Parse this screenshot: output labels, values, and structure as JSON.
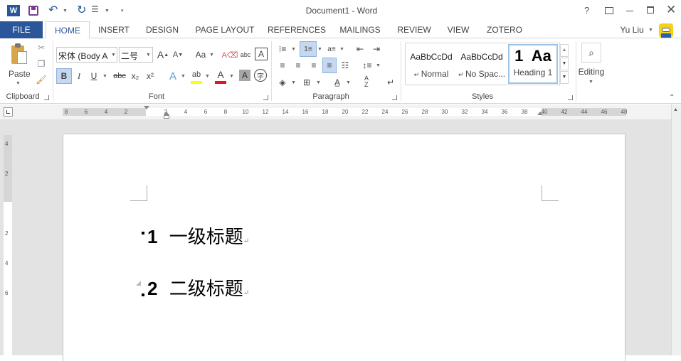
{
  "title_bar": {
    "document_title": "Document1 - Word",
    "help": "?",
    "window_controls": [
      "restore-ribbon",
      "minimize",
      "maximize",
      "close"
    ]
  },
  "tabs": {
    "file": "FILE",
    "items": [
      "HOME",
      "INSERT",
      "DESIGN",
      "PAGE LAYOUT",
      "REFERENCES",
      "MAILINGS",
      "REVIEW",
      "VIEW",
      "ZOTERO"
    ],
    "active": "HOME",
    "user": "Yu Liu"
  },
  "clipboard": {
    "paste": "Paste",
    "group_label": "Clipboard"
  },
  "font": {
    "family": "宋体 (Body A",
    "size": "二号",
    "group_label": "Font",
    "bold": "B",
    "italic": "I",
    "underline": "U",
    "strike": "abc",
    "sub": "x₂",
    "sup": "x²",
    "case": "Aa",
    "clear": "abc",
    "grow": "A",
    "shrink": "A",
    "effects": "A",
    "highlight": "ab",
    "font_color": "A",
    "shading": "A",
    "phonetic": "字"
  },
  "paragraph": {
    "group_label": "Paragraph"
  },
  "styles": {
    "group_label": "Styles",
    "items": [
      {
        "preview": "AaBbCcDd",
        "name": "Normal"
      },
      {
        "preview": "AaBbCcDd",
        "name": "No Spac..."
      },
      {
        "preview": "1  Aa",
        "name": "Heading 1"
      }
    ]
  },
  "editing": {
    "label": "Editing"
  },
  "ruler": {
    "numbers": [
      "8",
      "6",
      "4",
      "2",
      "",
      "2",
      "4",
      "6",
      "8",
      "10",
      "12",
      "14",
      "16",
      "18",
      "20",
      "22",
      "24",
      "26",
      "28",
      "30",
      "32",
      "34",
      "36",
      "38",
      "40",
      "42",
      "44",
      "46",
      "48"
    ]
  },
  "vertical_ruler": {
    "numbers": [
      "4",
      "2",
      "",
      "2",
      "4",
      "6"
    ]
  },
  "document": {
    "headings": [
      {
        "number": "1",
        "text": "一级标题"
      },
      {
        "number": "2",
        "text": "二级标题"
      }
    ],
    "paragraph_mark": "↵"
  },
  "colors": {
    "accent": "#2b579a",
    "file_tab": "#2b579a",
    "workspace": "#e3e3e3",
    "highlight_yellow": "#ffff00",
    "font_red": "#e81123",
    "selected_button": "#c5d8ef"
  }
}
